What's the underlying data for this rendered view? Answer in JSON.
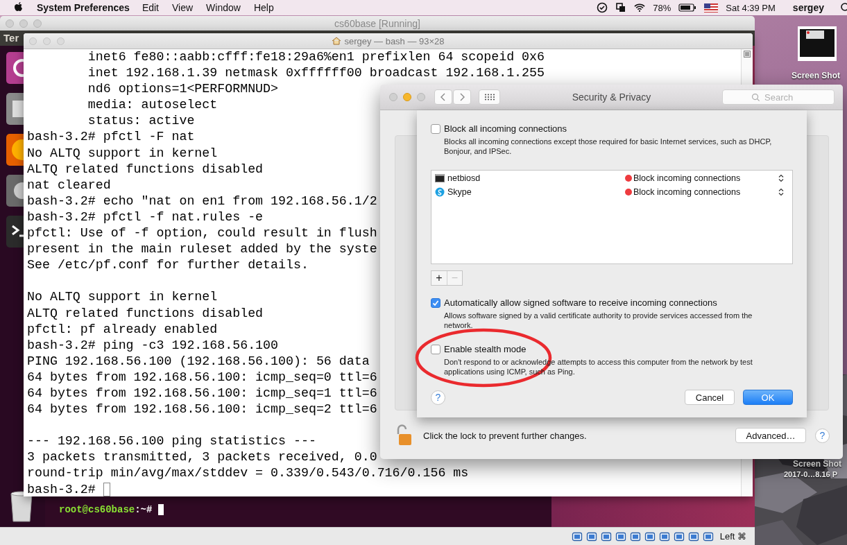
{
  "menu_bar": {
    "app_name": "System Preferences",
    "menus": [
      "Edit",
      "View",
      "Window",
      "Help"
    ],
    "battery": "78%",
    "clock": "Sat 4:39 PM",
    "user": "sergey"
  },
  "vm_window": {
    "title": "cs60base [Running]",
    "panel_title": "Ter",
    "guest_terminal": {
      "prompt_user": "root@cs60base",
      "prompt_path": ":~#"
    },
    "host_key": "Left ⌘"
  },
  "desktop": {
    "files": [
      {
        "label": "Screen Shot"
      },
      {
        "label": "Screen Shot",
        "date": "2017-0…8.16 P"
      }
    ]
  },
  "terminal": {
    "title": "sergey — bash — 93×28",
    "blocks": [
      [
        "        inet6 fe80::aabb:cfff:fe18:29a6%en1 prefixlen 64 scopeid 0x6",
        "        inet 192.168.1.39 netmask 0xffffff00 broadcast 192.168.1.255",
        "        nd6 options=1<PERFORMNUD>",
        "        media: autoselect",
        "        status: active",
        "bash-3.2# pfctl -F nat",
        "No ALTQ support in kernel",
        "ALTQ related functions disabled",
        "nat cleared",
        "bash-3.2# echo \"nat on en1 from 192.168.56.1/2",
        "bash-3.2# pfctl -f nat.rules -e",
        "pfctl: Use of -f option, could result in flush",
        "present in the main ruleset added by the syste",
        "See /etc/pf.conf for further details."
      ],
      [
        "No ALTQ support in kernel",
        "ALTQ related functions disabled",
        "pfctl: pf already enabled",
        "bash-3.2# ping -c3 192.168.56.100",
        "PING 192.168.56.100 (192.168.56.100): 56 data",
        "64 bytes from 192.168.56.100: icmp_seq=0 ttl=6",
        "64 bytes from 192.168.56.100: icmp_seq=1 ttl=6",
        "64 bytes from 192.168.56.100: icmp_seq=2 ttl=6"
      ],
      [
        "--- 192.168.56.100 ping statistics ---",
        "3 packets transmitted, 3 packets received, 0.0",
        "round-trip min/avg/max/stddev = 0.339/0.543/0.716/0.156 ms",
        "bash-3.2# "
      ]
    ]
  },
  "security": {
    "title": "Security & Privacy",
    "search": {
      "placeholder": "Search"
    },
    "block_all": {
      "label": "Block all incoming connections",
      "checked": false,
      "description": "Blocks all incoming connections except those required for basic Internet services,  such as DHCP, Bonjour, and IPSec."
    },
    "apps": [
      {
        "name": "netbiosd",
        "kind": "terminal",
        "allowed": false,
        "status": "Block incoming connections"
      },
      {
        "name": "Skype",
        "kind": "chat",
        "allowed": false,
        "status": "Block incoming connections"
      }
    ],
    "list_buttons": [
      {
        "label": "+",
        "disabled": false
      },
      {
        "label": "−",
        "disabled": true
      }
    ],
    "options": [
      {
        "label": "Automatically allow signed software to receive incoming connections",
        "checked": true,
        "circled": false,
        "description": "Allows software signed by a valid certificate authority to provide services accessed from the network."
      },
      {
        "label": "Enable stealth mode",
        "checked": false,
        "circled": true,
        "description": "Don't respond to or acknowledge attempts to access this computer from the network by test applications using ICMP, such as Ping."
      }
    ],
    "help": "?",
    "buttons": [
      {
        "label": "Cancel",
        "default": false
      },
      {
        "label": "OK",
        "default": true
      }
    ],
    "footer": {
      "locked": false,
      "lock_text": "Click the lock to prevent further changes.",
      "advanced": "Advanced…",
      "help": "?"
    }
  }
}
